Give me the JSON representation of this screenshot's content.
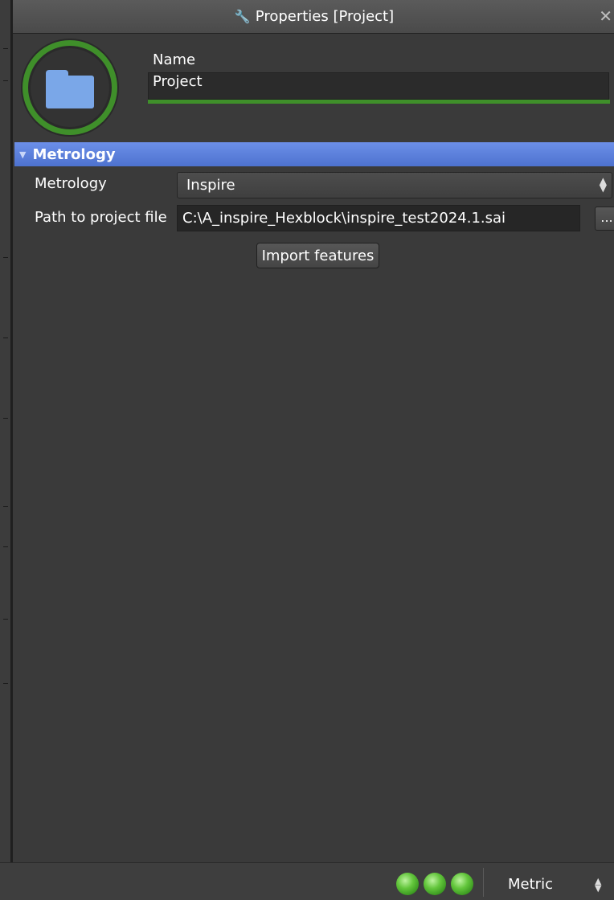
{
  "window": {
    "title": "Properties [Project]",
    "title_icon": "wrench-icon",
    "close_symbol": "✕"
  },
  "header": {
    "icon": "folder-icon",
    "ring_color": "#3f8f2a",
    "name_label": "Name",
    "name_value": "Project"
  },
  "section": {
    "title": "Metrology",
    "expanded": true,
    "color": "#5b80dc"
  },
  "fields": {
    "metrology_label": "Metrology",
    "metrology_value": "Inspire",
    "path_label": "Path to project file",
    "path_value": "C:\\A_inspire_Hexblock\\inspire_test2024.1.sai",
    "browse_label": "...",
    "import_button": "Import features"
  },
  "statusbar": {
    "lights": [
      "green",
      "green",
      "green"
    ],
    "units_value": "Metric"
  }
}
